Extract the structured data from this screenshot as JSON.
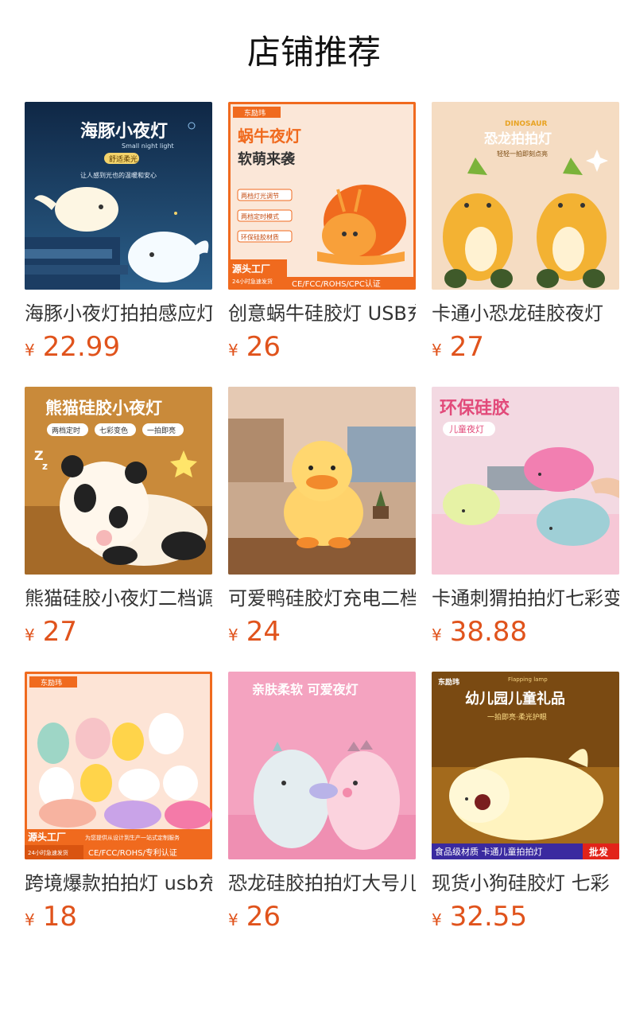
{
  "header": {
    "title": "店铺推荐"
  },
  "products": [
    {
      "name": "海豚小夜灯拍拍感应灯",
      "currency": "¥",
      "price": "22.99",
      "thumb": {
        "headline": "海豚小夜灯",
        "sub": "Small night light",
        "tag": "舒适柔光",
        "line": "让人感到光也的温暖和安心",
        "accent": "#1f3a5c",
        "icon": "whale-lamp"
      }
    },
    {
      "name": "创意蜗牛硅胶灯 USB充电",
      "currency": "¥",
      "price": "26",
      "thumb": {
        "brand": "东励玮",
        "headline": "蜗牛夜灯",
        "sub": "软萌来袭",
        "chips": [
          "两档灯光调节",
          "两档定时模式",
          "环保硅胶材质"
        ],
        "badge": "源头工厂",
        "badge_sub": "24小时急速发货",
        "cert": "CE/FCC/ROHS/CPC认证",
        "accent": "#f06a1e",
        "icon": "snail-lamp"
      }
    },
    {
      "name": "卡通小恐龙硅胶夜灯",
      "currency": "¥",
      "price": "27",
      "thumb": {
        "brand": "DINOSAUR",
        "headline": "恐龙拍拍灯",
        "sub": "轻轻一拍即刻点亮",
        "accent": "#f3b233",
        "icon": "dinosaur-lamp"
      }
    },
    {
      "name": "熊猫硅胶小夜灯二档调光",
      "currency": "¥",
      "price": "27",
      "thumb": {
        "headline": "熊猫硅胶小夜灯",
        "chips": [
          "两档定时",
          "七彩变色",
          "一拍即亮"
        ],
        "accent": "#c98a3a",
        "icon": "panda-lamp"
      }
    },
    {
      "name": "可爱鸭硅胶灯充电二档",
      "currency": "¥",
      "price": "24",
      "thumb": {
        "accent": "#d9b08a",
        "icon": "duck-lamp"
      }
    },
    {
      "name": "卡通刺猬拍拍灯七彩变色",
      "currency": "¥",
      "price": "38.88",
      "thumb": {
        "headline": "环保硅胶",
        "sub": "儿童夜灯",
        "accent": "#e79ab6",
        "icon": "hedgehog-lamp"
      }
    },
    {
      "name": "跨境爆款拍拍灯 usb充电",
      "currency": "¥",
      "price": "18",
      "thumb": {
        "brand": "东励玮",
        "badge": "源头工厂",
        "badge_sub": "24小时急速发货",
        "line": "为您提供从设计到生产一站式定制服务",
        "cert": "CE/FCC/ROHS/专利认证",
        "accent": "#f48a4a",
        "icon": "animal-lamps"
      }
    },
    {
      "name": "恐龙硅胶拍拍灯大号儿童",
      "currency": "¥",
      "price": "26",
      "thumb": {
        "headline": "亲肤柔软 可爱夜灯",
        "accent": "#f07aa6",
        "icon": "dinosaur-pair-lamp"
      }
    },
    {
      "name": "现货小狗硅胶灯 七彩",
      "currency": "¥",
      "price": "32.55",
      "thumb": {
        "brand": "东励玮",
        "sub": "Flapping lamp",
        "headline": "幼儿园儿童礼品",
        "line": "一拍即亮·柔光护眼",
        "banner": "食品级材质 卡通儿童拍拍灯",
        "badge": "批发",
        "accent": "#e8a62a",
        "icon": "dog-lamp"
      }
    }
  ]
}
